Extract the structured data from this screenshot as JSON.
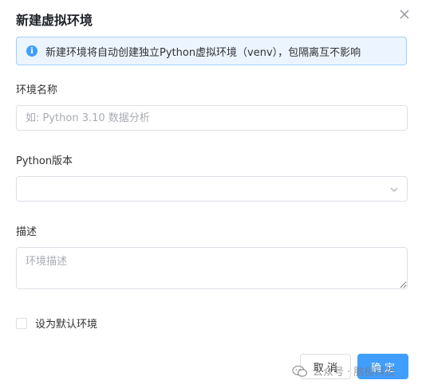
{
  "dialog": {
    "title": "新建虚拟环境",
    "alert": "新建环境将自动创建独立Python虚拟环境（venv），包隔离互不影响",
    "fields": {
      "name_label": "环境名称",
      "name_placeholder": "如: Python 3.10 数据分析",
      "version_label": "Python版本",
      "version_value": "",
      "description_label": "描述",
      "description_placeholder": "环境描述"
    },
    "default_checkbox": {
      "label": "设为默认环境",
      "checked": false
    },
    "buttons": {
      "cancel": "取 消",
      "confirm": "确 定"
    }
  },
  "watermark": {
    "text": "公众号 · 脑极科技"
  },
  "colors": {
    "primary": "#409eff",
    "alert_bg": "#ecf5ff",
    "border": "#dcdfe6"
  },
  "icons": [
    "close-icon",
    "info-icon",
    "chevron-down-icon",
    "wechat-icon"
  ]
}
